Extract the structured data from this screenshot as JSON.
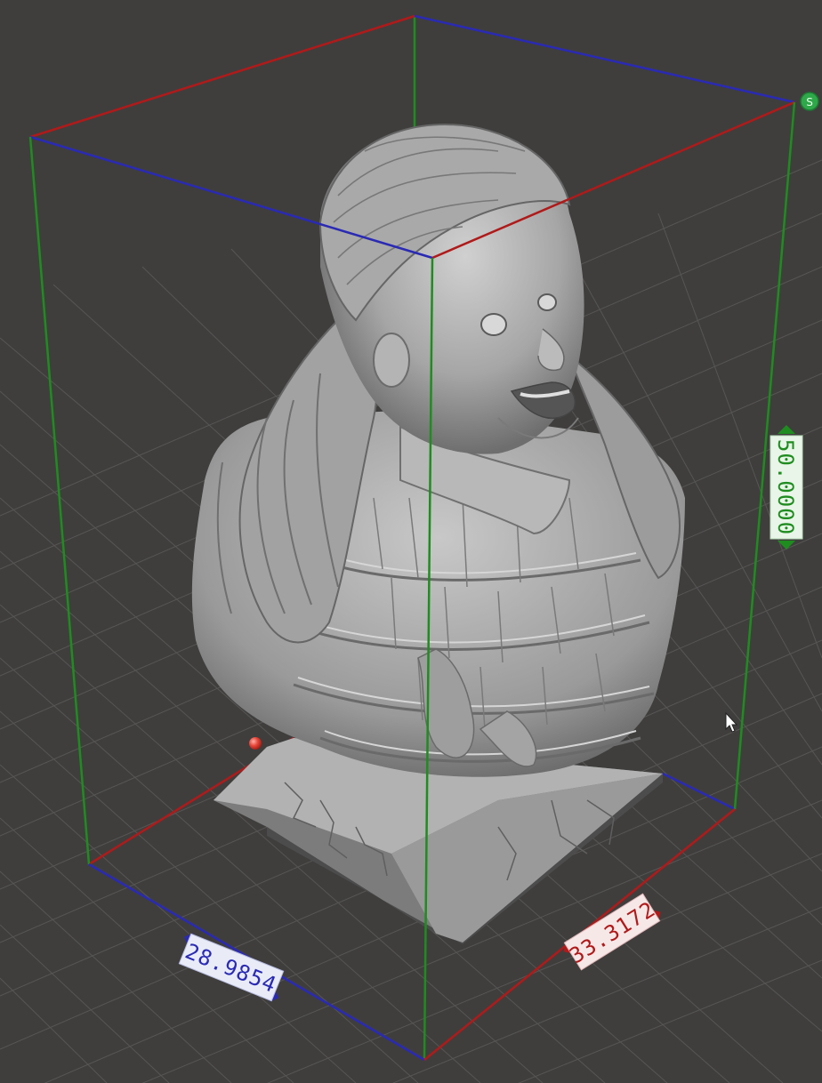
{
  "viewport": {
    "dimensions": {
      "width": "28.9854",
      "depth": "33.3172",
      "height": "50.0000"
    },
    "axis_colors": {
      "x": "#2a2ab4",
      "y": "#b01a1a",
      "z": "#1f8c1f"
    },
    "label_colors": {
      "width_bg": "#e9ecf7",
      "width_text": "#2a2ab4",
      "depth_bg": "#f7e8e8",
      "depth_text": "#b01a1a",
      "height_bg": "#e8f5e8",
      "height_text": "#1f8c1f"
    },
    "background_color": "#3f3e3d",
    "grid_color": "#5a5957",
    "model_color": "#a8a8a8",
    "scale_handle_icon": "S"
  }
}
